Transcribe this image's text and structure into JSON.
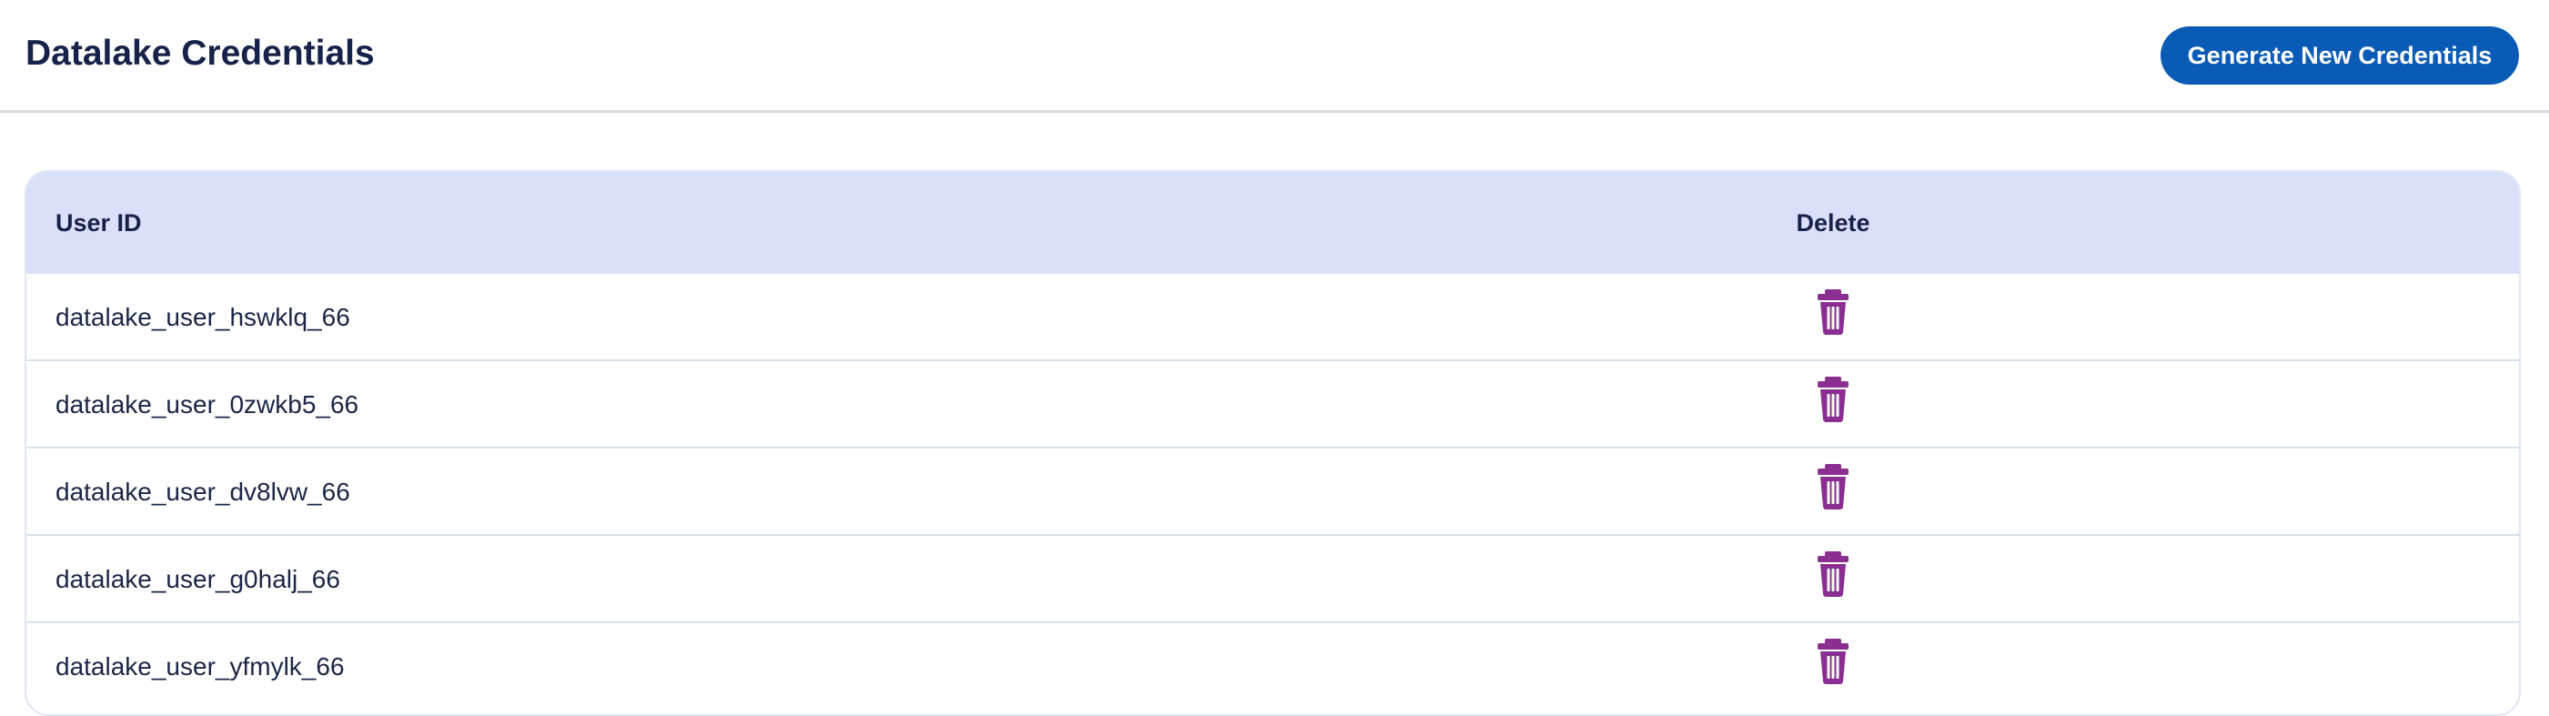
{
  "header": {
    "title": "Datalake Credentials",
    "generate_button_label": "Generate New Credentials"
  },
  "table": {
    "columns": {
      "user_id": "User ID",
      "delete": "Delete"
    },
    "rows": [
      {
        "user_id": "datalake_user_hswklq_66"
      },
      {
        "user_id": "datalake_user_0zwkb5_66"
      },
      {
        "user_id": "datalake_user_dv8lvw_66"
      },
      {
        "user_id": "datalake_user_g0halj_66"
      },
      {
        "user_id": "datalake_user_yfmylk_66"
      }
    ]
  },
  "icons": {
    "delete": "trash-icon"
  },
  "colors": {
    "primary_button": "#0a5bb5",
    "table_header_bg": "#dbe0fa",
    "trash_icon": "#8a2f91",
    "title_text": "#17224a"
  }
}
